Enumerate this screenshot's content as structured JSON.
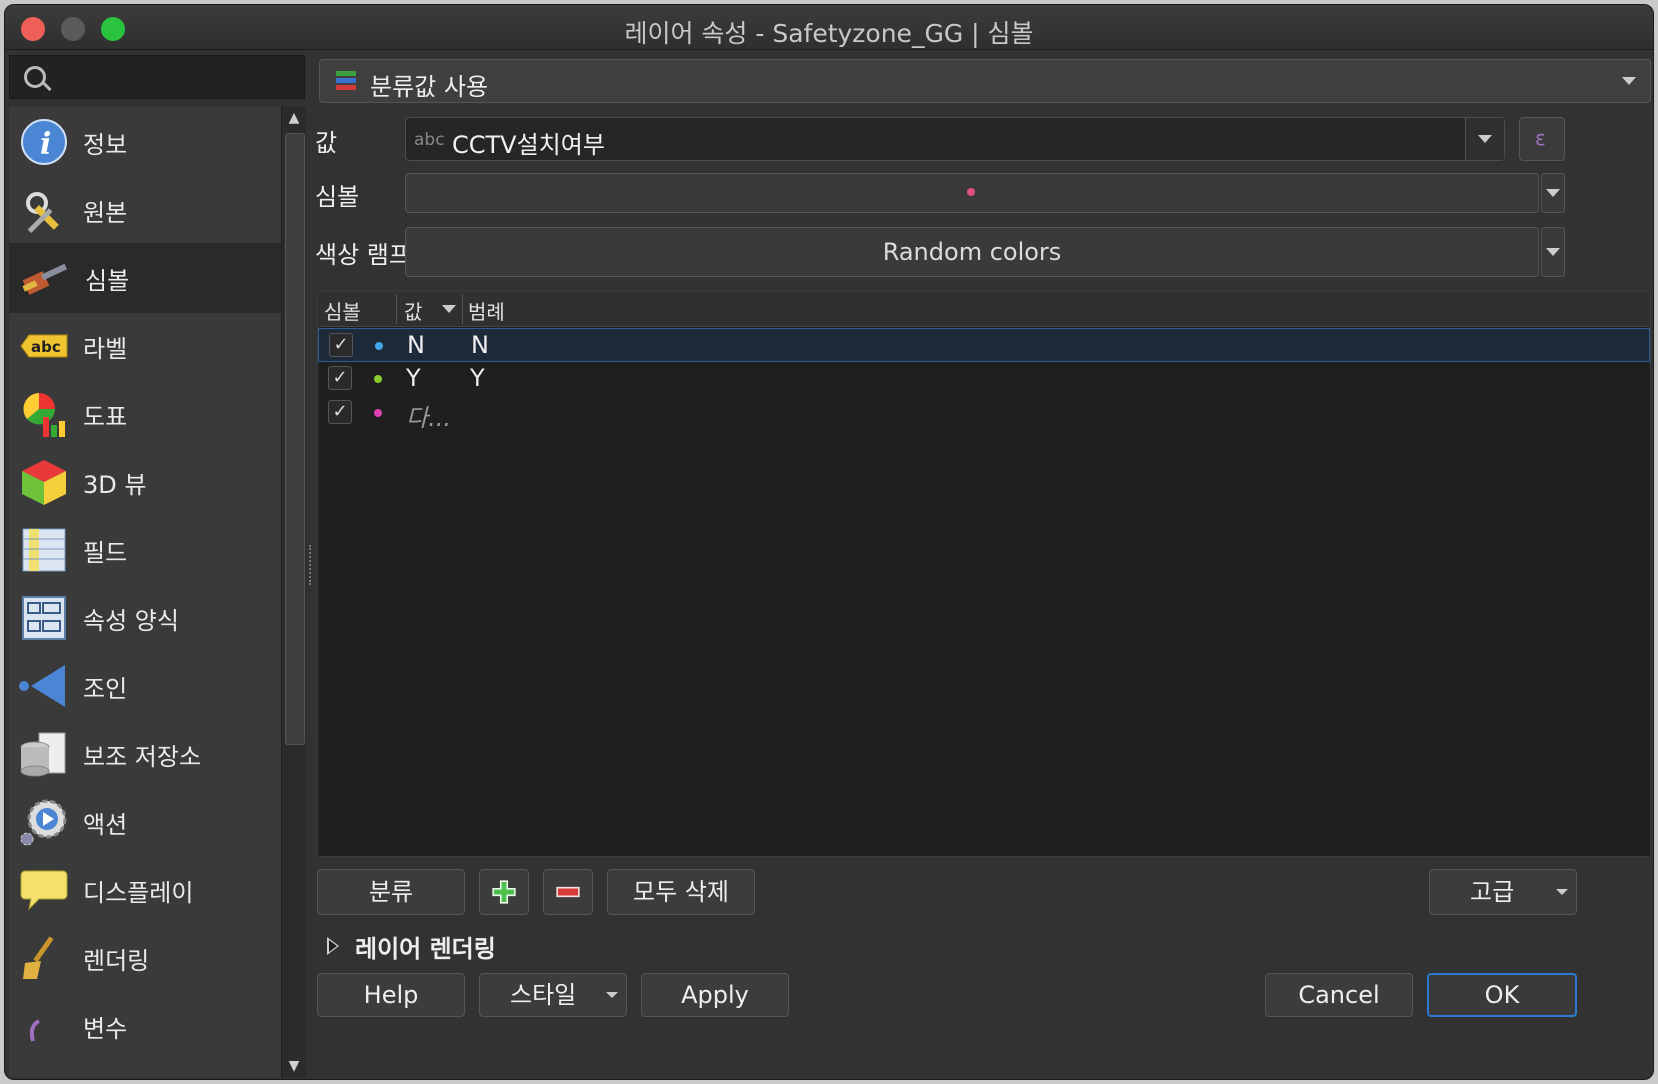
{
  "window": {
    "title": "레이어 속성 - Safetyzone_GG | 심볼"
  },
  "search": {
    "placeholder": ""
  },
  "sidebar": {
    "items": [
      {
        "label": "정보",
        "icon": "info-icon"
      },
      {
        "label": "원본",
        "icon": "source-tools-icon"
      },
      {
        "label": "심볼",
        "icon": "symbology-brush-icon",
        "selected": true
      },
      {
        "label": "라벨",
        "icon": "label-abc-icon"
      },
      {
        "label": "도표",
        "icon": "diagram-icon"
      },
      {
        "label": "3D 뷰",
        "icon": "3d-cube-icon"
      },
      {
        "label": "필드",
        "icon": "fields-icon"
      },
      {
        "label": "속성 양식",
        "icon": "attributes-form-icon"
      },
      {
        "label": "조인",
        "icon": "join-icon"
      },
      {
        "label": "보조 저장소",
        "icon": "auxiliary-storage-icon"
      },
      {
        "label": "액션",
        "icon": "action-gear-icon"
      },
      {
        "label": "디스플레이",
        "icon": "display-tip-icon"
      },
      {
        "label": "렌더링",
        "icon": "rendering-brush-icon"
      },
      {
        "label": "변수",
        "icon": "variables-icon"
      }
    ]
  },
  "renderer": {
    "label": "분류값 사용"
  },
  "value_row": {
    "label": "값",
    "type_badge": "abc",
    "field": "CCTV설치여부"
  },
  "symbol_row": {
    "label": "심볼",
    "dot_color": "#e0507a"
  },
  "ramp_row": {
    "label": "색상 램프",
    "value": "Random colors"
  },
  "table": {
    "headers": {
      "symbol": "심볼",
      "value": "값",
      "legend": "범례"
    },
    "rows": [
      {
        "checked": "✓",
        "dot_color": "#3fa7e8",
        "value": "N",
        "legend": "N",
        "selected": true
      },
      {
        "checked": "✓",
        "dot_color": "#8acd2a",
        "value": "Y",
        "legend": "Y"
      },
      {
        "checked": "✓",
        "dot_color": "#e040b0",
        "value": "다...",
        "legend": ""
      }
    ]
  },
  "buttons": {
    "classify": "분류",
    "delete_all": "모두 삭제",
    "advanced": "고급",
    "help": "Help",
    "style": "스타일",
    "apply": "Apply",
    "cancel": "Cancel",
    "ok": "OK"
  },
  "layer_rendering": {
    "label": "레이어 렌더링"
  }
}
